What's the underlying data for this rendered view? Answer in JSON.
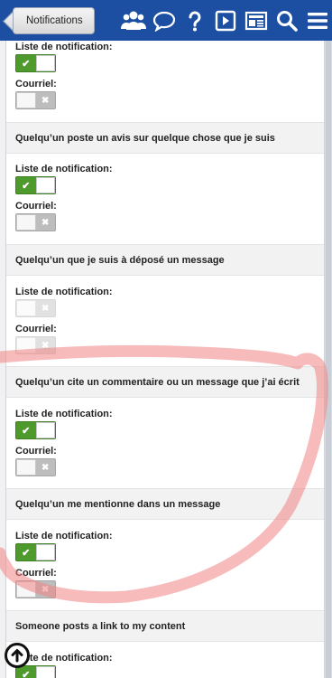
{
  "header": {
    "back_label": "Notifications",
    "icons": [
      "members-icon",
      "chat-icon",
      "help-icon",
      "video-icon",
      "news-icon",
      "search-icon",
      "menu-icon"
    ],
    "accent_color": "#1c4ea1"
  },
  "top_partial": {
    "list_label": "Liste de notification:",
    "list_on": true,
    "email_label": "Courriel:",
    "email_on": false
  },
  "sections": [
    {
      "title": "Quelqu’un poste un avis sur quelque chose que je suis",
      "list_label": "Liste de notification:",
      "list_on": true,
      "email_label": "Courriel:",
      "email_on": false,
      "disabled": false
    },
    {
      "title": "Quelqu’un que je suis à déposé un message",
      "list_label": "Liste de notification:",
      "list_on": false,
      "email_label": "Courriel:",
      "email_on": false,
      "disabled": true
    },
    {
      "title": "Quelqu’un cite un commentaire ou un message que j’ai écrit",
      "list_label": "Liste de notification:",
      "list_on": true,
      "email_label": "Courriel:",
      "email_on": false,
      "disabled": false
    },
    {
      "title": "Quelqu’un me mentionne dans un message",
      "list_label": "Liste de notification:",
      "list_on": true,
      "email_label": "Courriel:",
      "email_on": false,
      "disabled": false
    },
    {
      "title": "Someone posts a link to my content",
      "list_label": "Liste de notification:",
      "list_on": true,
      "email_label": "",
      "email_on": false,
      "disabled": false
    }
  ],
  "toggle_marks": {
    "on": "✔",
    "off": "✖"
  },
  "colors": {
    "toggle_on": "#4e9a2d",
    "toggle_off": "#bdbdbd",
    "annotation": "#f28c8c"
  },
  "scroll_top_icon": "arrow-up-circle-icon"
}
